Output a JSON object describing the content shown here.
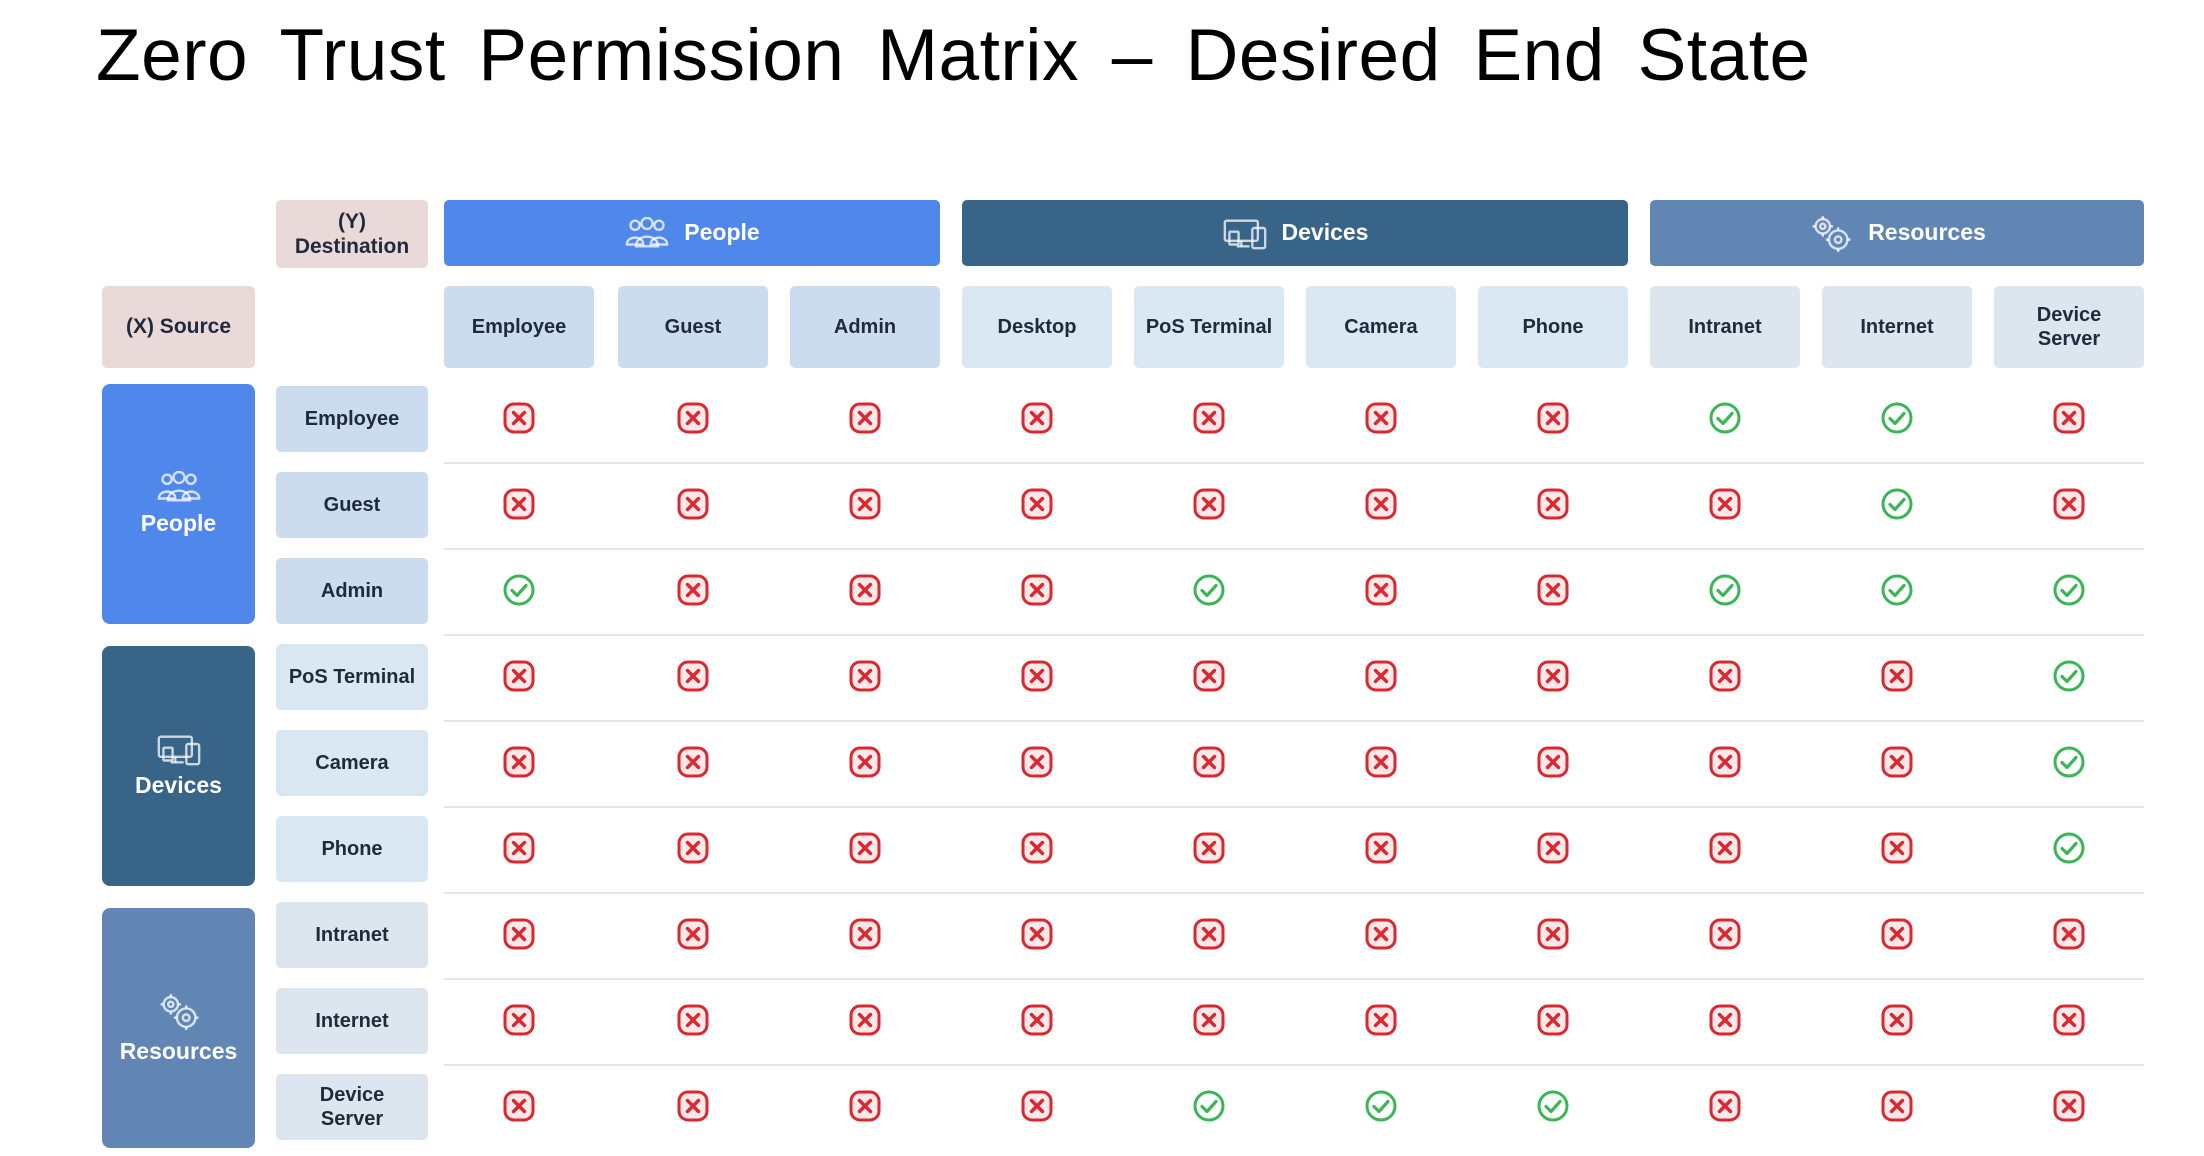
{
  "title": "Zero Trust Permission Matrix – Desired End State",
  "destination_header": "(Y)\nDestination",
  "source_header": "(X) Source",
  "colors": {
    "people": "#4f87eb",
    "devices": "#376487",
    "resources": "#6186b3",
    "sub_people": "#cbdcee",
    "sub_devices": "#d9e8f3",
    "sub_resources": "#dde5ee",
    "allow": "#3bb556",
    "deny": "#d9282f"
  },
  "groups": [
    {
      "label": "People",
      "icon": "people-icon",
      "items": [
        "Employee",
        "Guest",
        "Admin"
      ]
    },
    {
      "label": "Devices",
      "icon": "devices-icon",
      "items": [
        "Desktop",
        "PoS Terminal",
        "Camera",
        "Phone"
      ]
    },
    {
      "label": "Resources",
      "icon": "resources-icon",
      "items": [
        "Intranet",
        "Internet",
        "Device\nServer"
      ]
    }
  ],
  "source_groups": [
    {
      "label": "People",
      "icon": "people-icon",
      "items": [
        "Employee",
        "Guest",
        "Admin"
      ]
    },
    {
      "label": "Devices",
      "icon": "devices-icon",
      "items": [
        "PoS Terminal",
        "Camera",
        "Phone"
      ]
    },
    {
      "label": "Resources",
      "icon": "resources-icon",
      "items": [
        "Intranet",
        "Internet",
        "Device\nServer"
      ]
    }
  ],
  "matrix": [
    [
      0,
      0,
      0,
      0,
      0,
      0,
      0,
      1,
      1,
      0
    ],
    [
      0,
      0,
      0,
      0,
      0,
      0,
      0,
      0,
      1,
      0
    ],
    [
      1,
      0,
      0,
      0,
      1,
      0,
      0,
      1,
      1,
      1
    ],
    [
      0,
      0,
      0,
      0,
      0,
      0,
      0,
      0,
      0,
      1
    ],
    [
      0,
      0,
      0,
      0,
      0,
      0,
      0,
      0,
      0,
      1
    ],
    [
      0,
      0,
      0,
      0,
      0,
      0,
      0,
      0,
      0,
      1
    ],
    [
      0,
      0,
      0,
      0,
      0,
      0,
      0,
      0,
      0,
      0
    ],
    [
      0,
      0,
      0,
      0,
      0,
      0,
      0,
      0,
      0,
      0
    ],
    [
      0,
      0,
      0,
      0,
      1,
      1,
      1,
      0,
      0,
      0
    ]
  ],
  "legend": {
    "allow": "check-circle-icon",
    "deny": "x-square-icon"
  }
}
